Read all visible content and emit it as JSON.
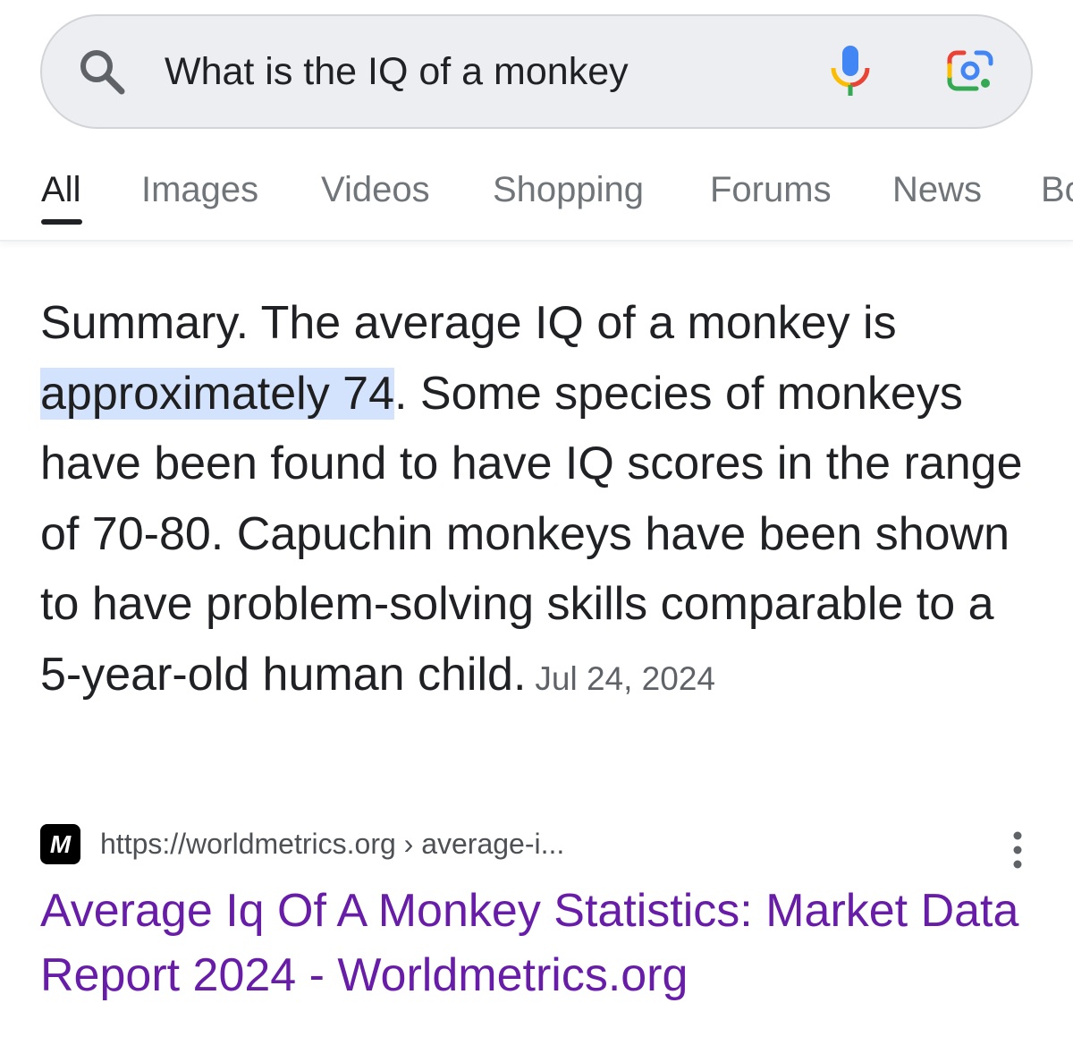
{
  "search": {
    "query": "What is the IQ of a monkey",
    "icons": [
      "search-icon",
      "mic-icon",
      "lens-icon"
    ]
  },
  "tabs": [
    {
      "label": "All",
      "active": true
    },
    {
      "label": "Images"
    },
    {
      "label": "Videos"
    },
    {
      "label": "Shopping"
    },
    {
      "label": "Forums"
    },
    {
      "label": "News"
    },
    {
      "label": "Bo"
    }
  ],
  "summary": {
    "before": "Summary. The average IQ of a monkey is ",
    "highlight": "approximately 74",
    "after": ". Some species of monkeys have been found to have IQ scores in the range of 70-80. Capuchin monkeys have been shown to have problem-solving skills comparable to a 5-year-old human child.",
    "date": "Jul 24, 2024"
  },
  "result": {
    "favicon_letter": "M",
    "url": "https://worldmetrics.org",
    "url_path": " › average-i...",
    "title": "Average Iq Of A Monkey Statistics: Market Data Report 2024 - Worldmetrics.org"
  },
  "colors": {
    "link": "#681da8",
    "highlight": "#d3e3fd",
    "google_blue": "#4285f4",
    "google_red": "#ea4335",
    "google_yellow": "#fbbc04",
    "google_green": "#34a853"
  }
}
